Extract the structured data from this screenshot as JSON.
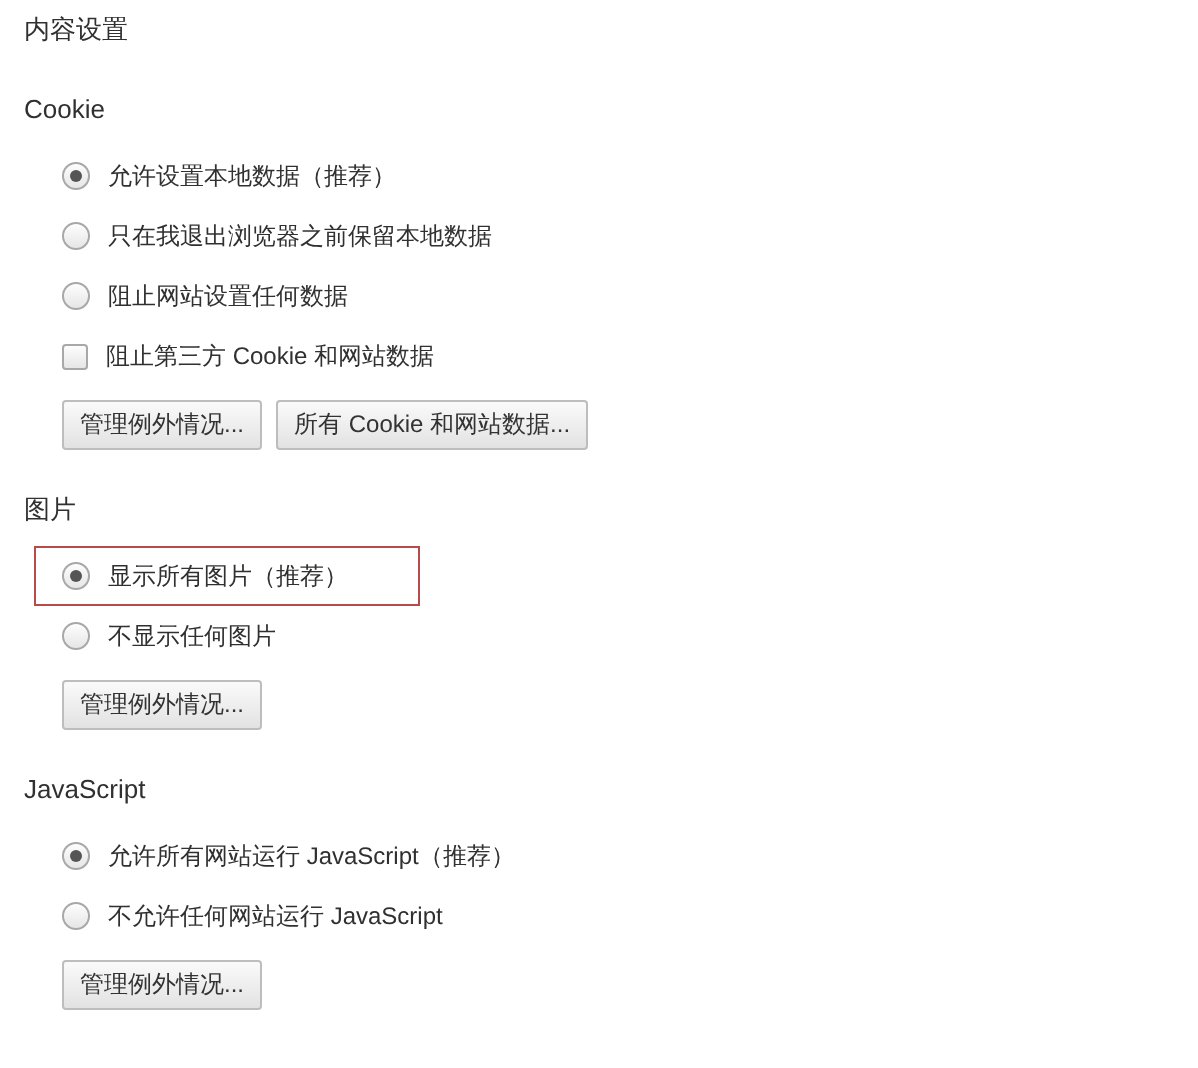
{
  "title": "内容设置",
  "sections": [
    {
      "heading": "Cookie",
      "options": [
        {
          "kind": "radio",
          "label": "允许设置本地数据（推荐）",
          "selected": true,
          "highlighted": false
        },
        {
          "kind": "radio",
          "label": "只在我退出浏览器之前保留本地数据",
          "selected": false,
          "highlighted": false
        },
        {
          "kind": "radio",
          "label": "阻止网站设置任何数据",
          "selected": false,
          "highlighted": false
        },
        {
          "kind": "checkbox",
          "label": "阻止第三方 Cookie 和网站数据",
          "checked": false,
          "highlighted": false
        }
      ],
      "buttons": [
        "管理例外情况...",
        "所有 Cookie 和网站数据..."
      ]
    },
    {
      "heading": "图片",
      "options": [
        {
          "kind": "radio",
          "label": "显示所有图片（推荐）",
          "selected": true,
          "highlighted": true
        },
        {
          "kind": "radio",
          "label": "不显示任何图片",
          "selected": false,
          "highlighted": false
        }
      ],
      "buttons": [
        "管理例外情况..."
      ]
    },
    {
      "heading": "JavaScript",
      "options": [
        {
          "kind": "radio",
          "label": "允许所有网站运行 JavaScript（推荐）",
          "selected": true,
          "highlighted": false
        },
        {
          "kind": "radio",
          "label": "不允许任何网站运行 JavaScript",
          "selected": false,
          "highlighted": false
        }
      ],
      "buttons": [
        "管理例外情况..."
      ]
    }
  ]
}
